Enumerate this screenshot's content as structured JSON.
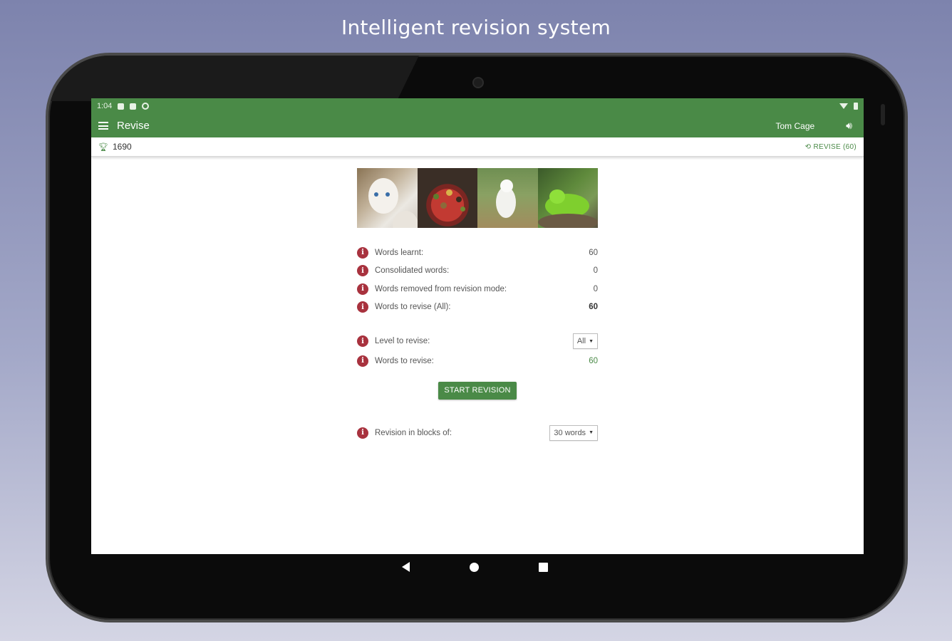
{
  "headline": "Intelligent revision system",
  "statusbar": {
    "time": "1:04"
  },
  "appbar": {
    "title": "Revise",
    "user": "Tom Cage"
  },
  "subbar": {
    "points": "1690",
    "revise_link": "REVISE (60)"
  },
  "stats": [
    {
      "label": "Words learnt:",
      "value": "60"
    },
    {
      "label": "Consolidated words:",
      "value": "0"
    },
    {
      "label": "Words removed from revision mode:",
      "value": "0"
    },
    {
      "label": "Words to revise (All):",
      "value": "60"
    }
  ],
  "level": {
    "label": "Level to revise:",
    "selected": "All"
  },
  "to_revise": {
    "label": "Words to revise:",
    "value": "60"
  },
  "start_button": "START REVISION",
  "blocks": {
    "label": "Revision in blocks of:",
    "selected": "30 words"
  },
  "colors": {
    "primary": "#4a8a47",
    "info": "#a8323e"
  }
}
